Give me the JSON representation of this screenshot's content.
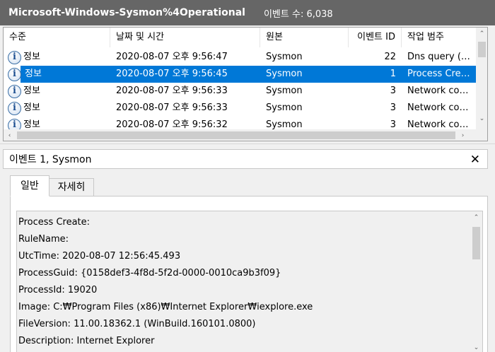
{
  "titlebar": {
    "log_name": "Microsoft-Windows-Sysmon%4Operational",
    "event_count": "이벤트 수: 6,038"
  },
  "list": {
    "columns": {
      "level": "수준",
      "datetime": "날짜 및 시간",
      "source": "원본",
      "event_id": "이벤트 ID",
      "category": "작업 범주"
    },
    "rows": [
      {
        "level": "정보",
        "datetime": "2020-08-07 오후 9:56:47",
        "source": "Sysmon",
        "event_id": "22",
        "category": "Dns query (…"
      },
      {
        "level": "정보",
        "datetime": "2020-08-07 오후 9:56:45",
        "source": "Sysmon",
        "event_id": "1",
        "category": "Process Cre…"
      },
      {
        "level": "정보",
        "datetime": "2020-08-07 오후 9:56:33",
        "source": "Sysmon",
        "event_id": "3",
        "category": "Network co…"
      },
      {
        "level": "정보",
        "datetime": "2020-08-07 오후 9:56:33",
        "source": "Sysmon",
        "event_id": "3",
        "category": "Network co…"
      },
      {
        "level": "정보",
        "datetime": "2020-08-07 오후 9:56:32",
        "source": "Sysmon",
        "event_id": "3",
        "category": "Network co…"
      }
    ],
    "selected_index": 1
  },
  "icons": {
    "info": "i",
    "close": "✕",
    "arrow_up": "⌃",
    "arrow_down": "⌄",
    "arrow_left": "‹",
    "arrow_right": "›"
  },
  "detail": {
    "title": "이벤트 1, Sysmon",
    "tabs": [
      "일반",
      "자세히"
    ],
    "lines": [
      "Process Create:",
      "RuleName:",
      "UtcTime: 2020-08-07 12:56:45.493",
      "ProcessGuid: {0158def3-4f8d-5f2d-0000-0010ca9b3f09}",
      "ProcessId: 19020",
      "Image: C:₩Program Files (x86)₩Internet Explorer₩iexplore.exe",
      "FileVersion: 11.00.18362.1 (WinBuild.160101.0800)",
      "Description: Internet Explorer"
    ]
  }
}
